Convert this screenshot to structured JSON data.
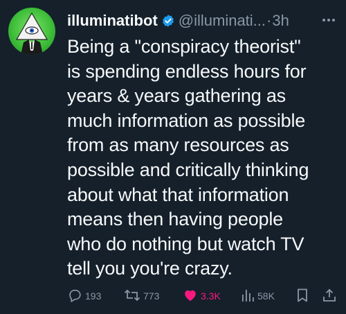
{
  "tweet": {
    "display_name": "illuminatibot",
    "handle": "@illuminati...",
    "separator": "·",
    "time": "3h",
    "text": "Being a \"conspiracy theorist\"\nis spending endless hours for\nyears & years gathering as\nmuch information as possible\nfrom as many resources as\npossible and critically thinking\nabout what that information\nmeans then having people\nwho do nothing but watch TV\ntell you you're crazy."
  },
  "actions": {
    "replies": "193",
    "retweets": "773",
    "likes": "3.3K",
    "views": "58K"
  },
  "colors": {
    "background": "#15202b",
    "text": "#f7f9f9",
    "muted": "#8b98a5",
    "like": "#f91880",
    "verified": "#1d9bf0",
    "avatar_green": "#3fbf3a"
  },
  "icons": {
    "verified": "verified-badge-icon",
    "more": "more-options-icon",
    "reply": "reply-icon",
    "retweet": "retweet-icon",
    "like": "heart-icon",
    "views": "views-chart-icon",
    "bookmark": "bookmark-icon",
    "share": "share-icon"
  }
}
